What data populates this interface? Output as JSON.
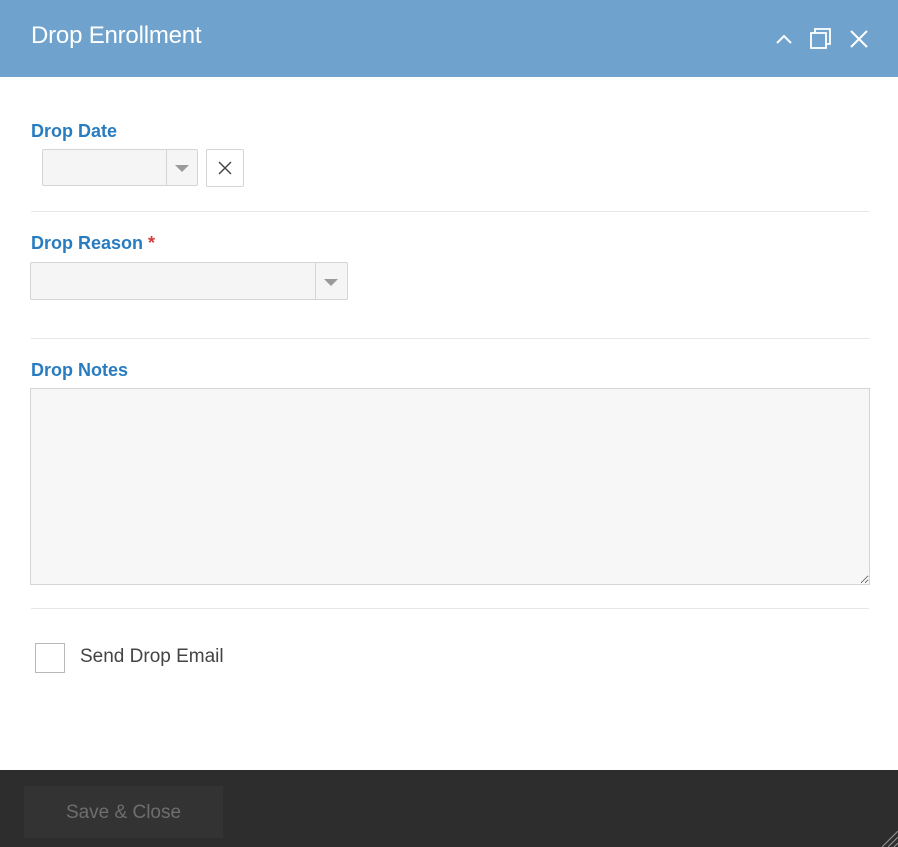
{
  "window": {
    "title": "Drop Enrollment",
    "controls": [
      "chevron-up-icon",
      "maximize-icon",
      "close-icon"
    ]
  },
  "fields": {
    "drop_date": {
      "label": "Drop Date",
      "value": ""
    },
    "drop_reason": {
      "label": "Drop Reason",
      "required_marker": "*",
      "value": ""
    },
    "drop_notes": {
      "label": "Drop Notes",
      "value": ""
    },
    "send_email": {
      "label": "Send Drop Email",
      "checked": false
    }
  },
  "footer": {
    "save_label": "Save & Close"
  },
  "colors": {
    "titlebar": "#6fa3cd",
    "label": "#2a7cc0",
    "required": "#d23b3b",
    "footer": "#2d2d2d"
  }
}
